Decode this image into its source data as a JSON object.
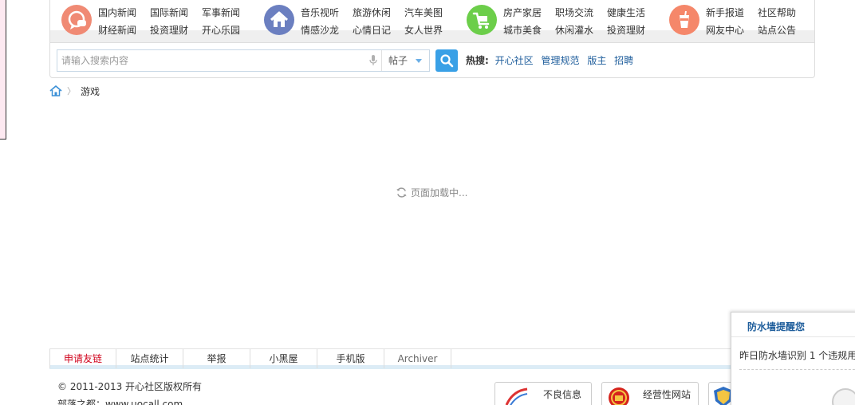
{
  "header": {
    "nav_groups": [
      {
        "icon": "speech-bubble-icon",
        "color": "#f08a74",
        "rows": [
          [
            "国内新闻",
            "国际新闻",
            "军事新闻"
          ],
          [
            "财经新闻",
            "投资理财",
            "开心乐园"
          ]
        ]
      },
      {
        "icon": "home-icon",
        "color": "#6b7fc0",
        "rows": [
          [
            "音乐视听",
            "旅游休闲",
            "汽车美图"
          ],
          [
            "情感沙龙",
            "心情日记",
            "女人世界"
          ]
        ]
      },
      {
        "icon": "cart-icon",
        "color": "#6cce4a",
        "rows": [
          [
            "房产家居",
            "职场交流",
            "健康生活"
          ],
          [
            "城市美食",
            "休闲灌水",
            "投资理财"
          ]
        ]
      },
      {
        "icon": "drink-icon",
        "color": "#f5876a",
        "rows": [
          [
            "新手报道",
            "社区帮助"
          ],
          [
            "网友中心",
            "站点公告"
          ]
        ]
      }
    ]
  },
  "search": {
    "placeholder": "请输入搜索内容",
    "value": "",
    "scope": "帖子",
    "hot_label": "热搜:",
    "hot_links": [
      "开心社区",
      "管理规范",
      "版主",
      "招聘"
    ],
    "accent_color": "#39a0e6"
  },
  "breadcrumb": {
    "current": "游戏"
  },
  "main": {
    "loading_text": "页面加载中..."
  },
  "footer": {
    "links": [
      "申请友链",
      "站点统计",
      "举报",
      "小黑屋",
      "手机版",
      "Archiver"
    ],
    "highlight_color": "#d0021b",
    "copyright": "© 2011-2013 开心社区版权所有",
    "sub_text": "部落之都：www.uocall.com",
    "badges": [
      "不良信息",
      "经营性网站"
    ]
  },
  "notice": {
    "title": "防水墙提醒您",
    "text": "昨日防水墙识别 1 个违规用"
  }
}
